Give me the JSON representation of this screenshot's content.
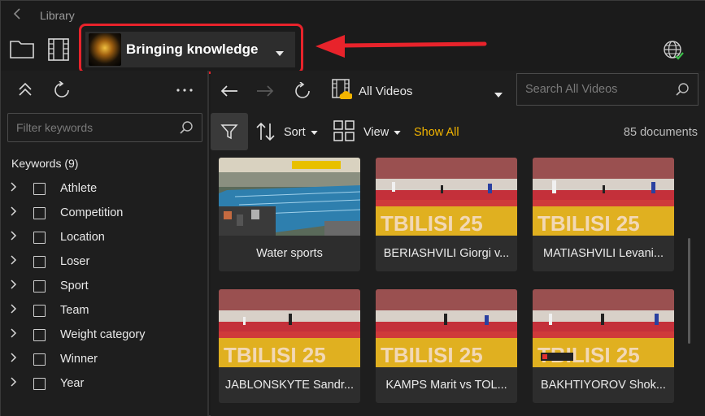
{
  "window": {
    "title": "Library"
  },
  "library": {
    "name": "Bringing knowledge"
  },
  "sidebar": {
    "filter_placeholder": "Filter keywords",
    "keywords_title": "Keywords (9)",
    "keywords": [
      {
        "label": "Athlete"
      },
      {
        "label": "Competition"
      },
      {
        "label": "Location"
      },
      {
        "label": "Loser"
      },
      {
        "label": "Sport"
      },
      {
        "label": "Team"
      },
      {
        "label": "Weight category"
      },
      {
        "label": "Winner"
      },
      {
        "label": "Year"
      }
    ]
  },
  "nav": {
    "collection_label": "All Videos",
    "search_placeholder": "Search All Videos"
  },
  "toolbar": {
    "sort_label": "Sort",
    "view_label": "View",
    "show_all_label": "Show All",
    "document_count": "85 documents"
  },
  "documents": [
    {
      "title": "Water sports",
      "thumb": "pool"
    },
    {
      "title": "BERIASHVILI Giorgi v...",
      "thumb": "judo"
    },
    {
      "title": "MATIASHVILI Levani...",
      "thumb": "judo"
    },
    {
      "title": "JABLONSKYTE Sandr...",
      "thumb": "judo"
    },
    {
      "title": "KAMPS Marit vs TOL...",
      "thumb": "judo"
    },
    {
      "title": "BAKHTIYOROV Shok...",
      "thumb": "judo"
    }
  ],
  "colors": {
    "accent_show_all": "#f2b400",
    "highlight": "#e8232b",
    "globe_check": "#3cbf4a"
  }
}
